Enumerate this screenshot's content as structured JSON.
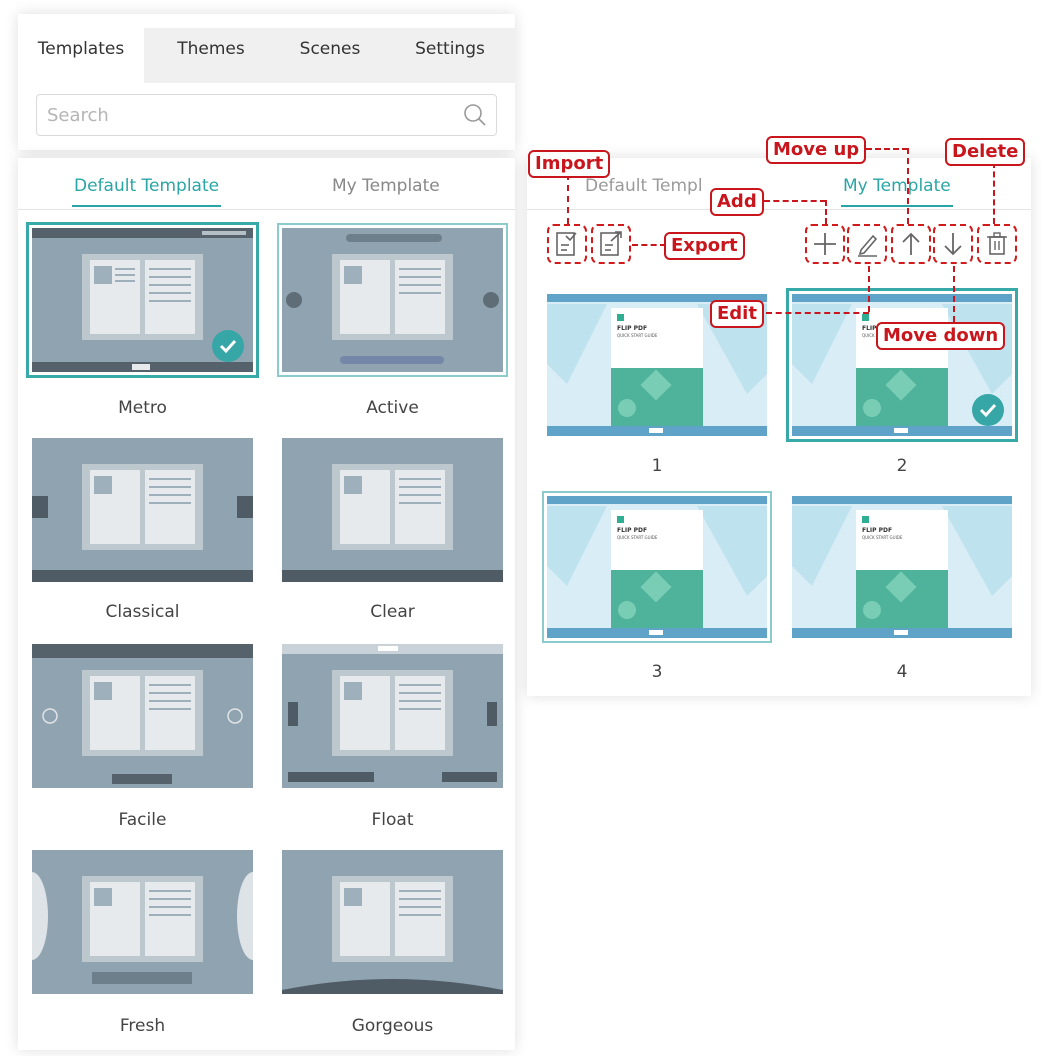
{
  "main_tabs": [
    {
      "label": "Templates"
    },
    {
      "label": "Themes"
    },
    {
      "label": "Scenes"
    },
    {
      "label": "Settings"
    }
  ],
  "search": {
    "placeholder": "Search"
  },
  "left_panel": {
    "tabs": [
      {
        "label": "Default Template"
      },
      {
        "label": "My Template"
      }
    ],
    "templates": [
      {
        "name": "Metro",
        "selected": true
      },
      {
        "name": "Active"
      },
      {
        "name": "Classical"
      },
      {
        "name": "Clear"
      },
      {
        "name": "Facile"
      },
      {
        "name": "Float"
      },
      {
        "name": "Fresh"
      },
      {
        "name": "Gorgeous"
      }
    ]
  },
  "right_panel": {
    "tabs": [
      {
        "label": "Default Templ"
      },
      {
        "label": "My Template"
      }
    ],
    "toolbar": [
      "import-icon",
      "export-icon",
      "add-icon",
      "edit-icon",
      "move-up-icon",
      "move-down-icon",
      "delete-icon"
    ],
    "items": [
      {
        "label": "1",
        "cover_title": "FLIP PDF",
        "cover_subtitle": "QUICK START GUIDE"
      },
      {
        "label": "2",
        "cover_title": "FLIP PDF",
        "cover_subtitle": "QUICK START GUIDE",
        "selected": true
      },
      {
        "label": "3",
        "cover_title": "FLIP PDF",
        "cover_subtitle": "QUICK START GUIDE"
      },
      {
        "label": "4",
        "cover_title": "FLIP PDF",
        "cover_subtitle": "QUICK START GUIDE"
      }
    ]
  },
  "callouts": {
    "import": "Import",
    "export": "Export",
    "add": "Add",
    "edit": "Edit",
    "move_up": "Move up",
    "move_down": "Move down",
    "delete": "Delete"
  },
  "colors": {
    "accent": "#2aa5a5",
    "annotation": "#c9161c",
    "thumb_bg": "#8fa3b1"
  }
}
